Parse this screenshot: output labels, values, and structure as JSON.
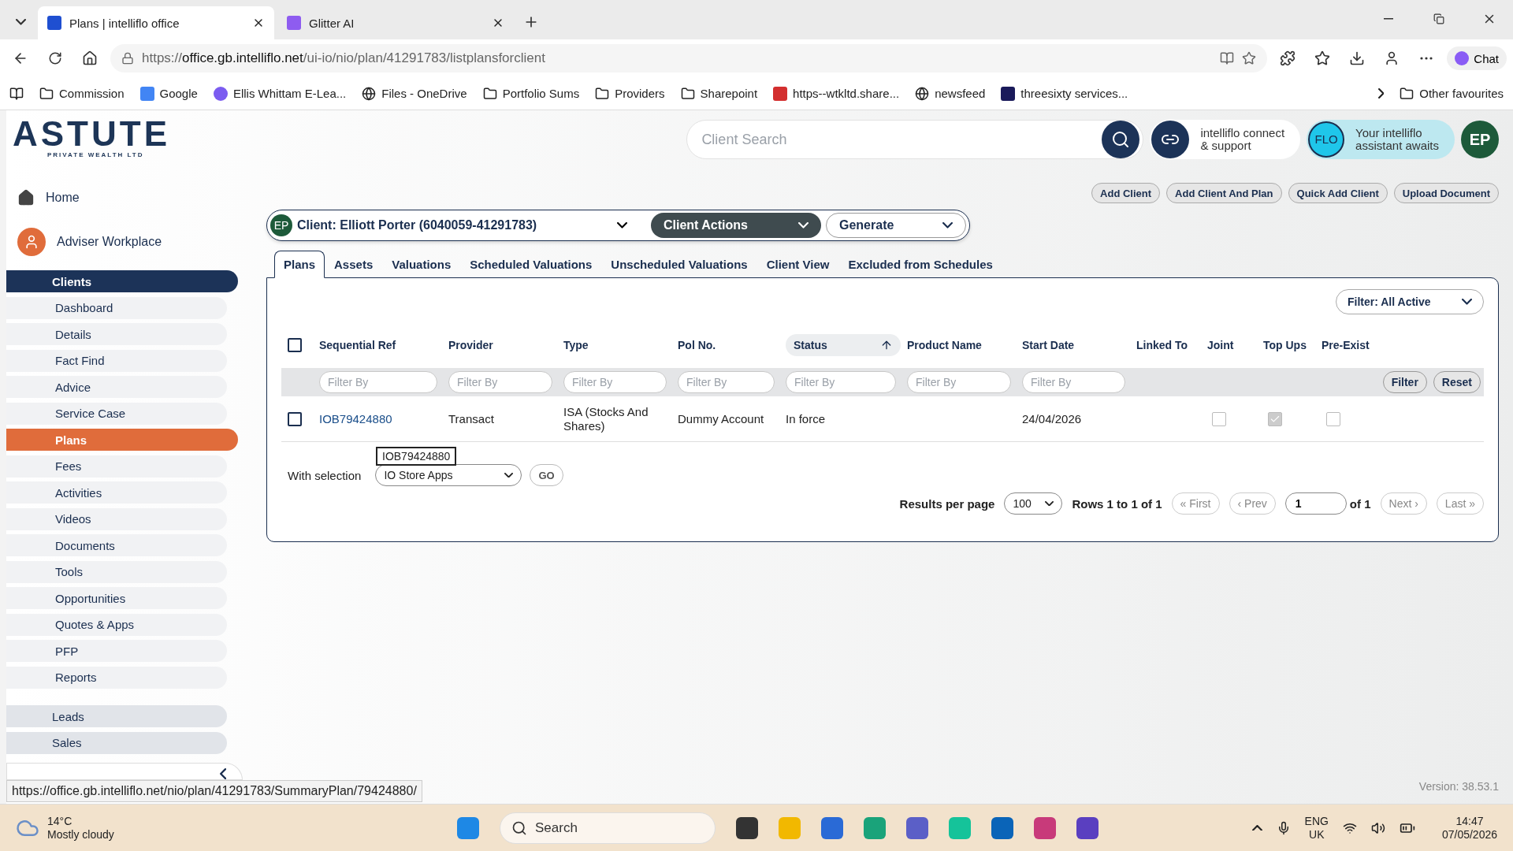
{
  "browser": {
    "tabs": [
      {
        "title": "Plans | intelliflo office",
        "kind": "intelliflo",
        "selected": true
      },
      {
        "title": "Glitter AI",
        "kind": "glitter",
        "selected": false
      }
    ],
    "url_scheme": "https://",
    "url_host": "office.gb.intelliflo.net",
    "url_path": "/ui-io/nio/plan/41291783/listplansforclient",
    "chat": "Chat",
    "bookmarks": [
      {
        "label": "Commission",
        "kind": "folder"
      },
      {
        "label": "Google",
        "kind": "google"
      },
      {
        "label": "Ellis Whittam E-Lea...",
        "kind": "circle"
      },
      {
        "label": "Files - OneDrive",
        "kind": "globe"
      },
      {
        "label": "Portfolio Sums",
        "kind": "folder"
      },
      {
        "label": "Providers",
        "kind": "folder"
      },
      {
        "label": "Sharepoint",
        "kind": "folder"
      },
      {
        "label": "https--wtkltd.share...",
        "kind": "pdf"
      },
      {
        "label": "newsfeed",
        "kind": "globe"
      },
      {
        "label": "threesixty services...",
        "kind": "tile"
      }
    ],
    "other_favourites": "Other favourites"
  },
  "logo": {
    "name": "ASTUTE",
    "subtitle": "PRIVATE WEALTH LTD"
  },
  "header": {
    "search_placeholder": "Client Search",
    "connect": [
      "intelliflo connect",
      "& support"
    ],
    "flo": "FLO",
    "assistant": [
      "Your intelliflo",
      "assistant awaits"
    ],
    "avatar": "EP"
  },
  "sidebar": {
    "home": "Home",
    "workplace": "Adviser Workplace",
    "items": [
      {
        "label": "Clients",
        "kind": "group",
        "selected": true
      },
      {
        "label": "Dashboard",
        "kind": "sub",
        "selected": false
      },
      {
        "label": "Details",
        "kind": "sub",
        "selected": false
      },
      {
        "label": "Fact Find",
        "kind": "sub",
        "selected": false
      },
      {
        "label": "Advice",
        "kind": "sub",
        "selected": false
      },
      {
        "label": "Service Case",
        "kind": "sub",
        "selected": false
      },
      {
        "label": "Plans",
        "kind": "sub",
        "selected": true
      },
      {
        "label": "Fees",
        "kind": "sub",
        "selected": false
      },
      {
        "label": "Activities",
        "kind": "sub",
        "selected": false
      },
      {
        "label": "Videos",
        "kind": "sub",
        "selected": false
      },
      {
        "label": "Documents",
        "kind": "sub",
        "selected": false
      },
      {
        "label": "Tools",
        "kind": "sub",
        "selected": false
      },
      {
        "label": "Opportunities",
        "kind": "sub",
        "selected": false
      },
      {
        "label": "Quotes & Apps",
        "kind": "sub",
        "selected": false
      },
      {
        "label": "PFP",
        "kind": "sub",
        "selected": false
      },
      {
        "label": "Reports",
        "kind": "sub",
        "selected": false
      },
      {
        "label": "Leads",
        "kind": "group",
        "selected": false
      },
      {
        "label": "Sales",
        "kind": "group",
        "selected": false
      }
    ]
  },
  "actions": [
    "Add Client",
    "Add Client And Plan",
    "Quick Add Client",
    "Upload Document"
  ],
  "client_bar": {
    "avatar": "EP",
    "label": "Client:",
    "name": "Elliott Porter (6040059-41291783)",
    "client_actions": "Client Actions",
    "generate": "Generate"
  },
  "tabs": [
    {
      "label": "Plans",
      "selected": true
    },
    {
      "label": "Assets",
      "selected": false
    },
    {
      "label": "Valuations",
      "selected": false
    },
    {
      "label": "Scheduled Valuations",
      "selected": false
    },
    {
      "label": "Unscheduled Valuations",
      "selected": false
    },
    {
      "label": "Client View",
      "selected": false
    },
    {
      "label": "Excluded from Schedules",
      "selected": false
    }
  ],
  "filter_dropdown": "Filter: All Active",
  "table": {
    "header_checked": false,
    "columns": [
      {
        "label": "Sequential Ref",
        "sorted": false,
        "placeholder": "Filter By"
      },
      {
        "label": "Provider",
        "sorted": false,
        "placeholder": "Filter By"
      },
      {
        "label": "Type",
        "sorted": false,
        "placeholder": "Filter By"
      },
      {
        "label": "Pol No.",
        "sorted": false,
        "placeholder": "Filter By"
      },
      {
        "label": "Status",
        "sorted": true,
        "placeholder": "Filter By"
      },
      {
        "label": "Product Name",
        "sorted": false,
        "placeholder": "Filter By"
      },
      {
        "label": "Start Date",
        "sorted": false,
        "placeholder": "Filter By"
      },
      {
        "label": "Linked To",
        "sorted": false
      },
      {
        "label": "Joint",
        "sorted": false
      },
      {
        "label": "Top Ups",
        "sorted": false
      },
      {
        "label": "Pre-Exist",
        "sorted": false
      }
    ],
    "filter_button": "Filter",
    "reset_button": "Reset",
    "rows": [
      {
        "selected": false,
        "ref": "IOB79424880",
        "provider": "Transact",
        "type": "ISA (Stocks And Shares)",
        "pol_no": "Dummy Account",
        "status": "In force",
        "start_date": "24/04/2026",
        "joint": false,
        "top_ups": true,
        "pre_exist": false
      }
    ],
    "tooltip": "IOB79424880"
  },
  "bulk": {
    "label": "With selection",
    "select": "IO Store Apps",
    "go": "GO"
  },
  "pagination": {
    "label": "Results per page",
    "per_page": "100",
    "rows": "Rows 1 to 1 of 1",
    "first": "« First",
    "prev": "‹ Prev",
    "page": "1",
    "of": "of 1",
    "next": "Next ›",
    "last": "Last »"
  },
  "version": "Version: 38.53.1",
  "status_url": "https://office.gb.intelliflo.net/nio/plan/41291783/SummaryPlan/79424880/",
  "taskbar": {
    "temp": "14°C",
    "weather": "Mostly cloudy",
    "search": "Search",
    "lang": "ENG",
    "region": "UK",
    "time": "14:47",
    "date": "07/05/2026"
  }
}
